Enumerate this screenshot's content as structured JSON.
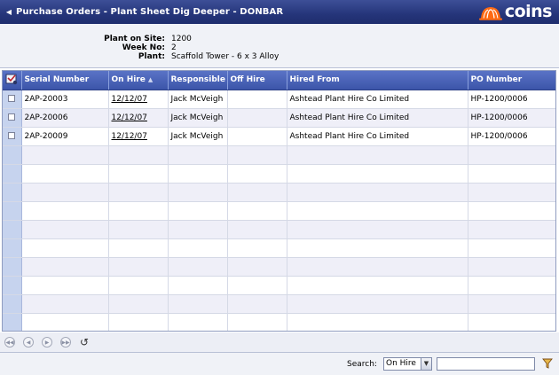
{
  "header": {
    "title": "Purchase Orders - Plant Sheet Dig Deeper - DONBAR",
    "logo_text": "coins",
    "accent": "#ff6a13"
  },
  "info": {
    "plant_on_site_label": "Plant on Site:",
    "plant_on_site": "1200",
    "week_no_label": "Week No:",
    "week_no": "2",
    "plant_label": "Plant:",
    "plant": "Scaffold Tower - 6 x 3 Alloy"
  },
  "grid": {
    "columns": [
      "Serial Number",
      "On Hire",
      "Responsible",
      "Off Hire",
      "Hired From",
      "PO Number"
    ],
    "sorted_column": "On Hire",
    "rows": [
      [
        "2AP-20003",
        "12/12/07",
        "Jack McVeigh",
        "",
        "Ashtead Plant Hire Co Limited",
        "HP-1200/0006"
      ],
      [
        "2AP-20006",
        "12/12/07",
        "Jack McVeigh",
        "",
        "Ashtead Plant Hire Co Limited",
        "HP-1200/0006"
      ],
      [
        "2AP-20009",
        "12/12/07",
        "Jack McVeigh",
        "",
        "Ashtead Plant Hire Co Limited",
        "HP-1200/0006"
      ]
    ],
    "empty_rows": 10
  },
  "pager": {
    "icons": [
      "first-page-icon",
      "previous-page-icon",
      "next-page-icon",
      "last-page-icon",
      "refresh-icon"
    ]
  },
  "footer": {
    "search_label": "Search:",
    "search_field_value": "On Hire",
    "search_text": "",
    "filter_icon": "filter-icon"
  }
}
